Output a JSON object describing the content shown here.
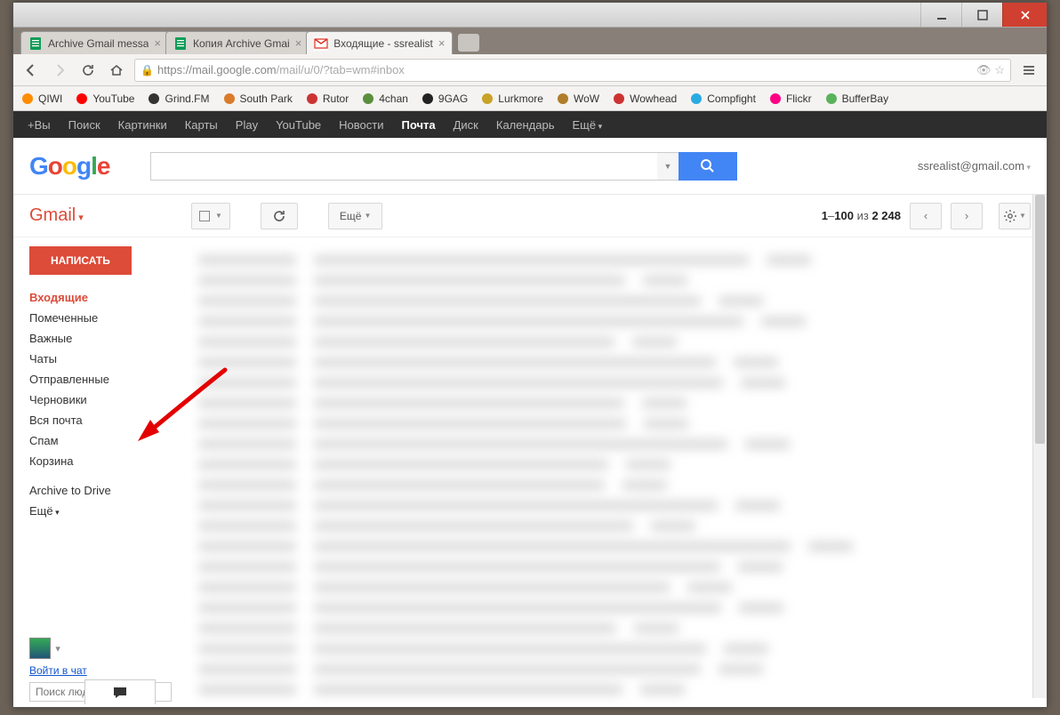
{
  "browser": {
    "tabs": [
      {
        "title": "Archive Gmail messa",
        "active": false,
        "icon": "sheets"
      },
      {
        "title": "Копия Archive Gmai",
        "active": false,
        "icon": "sheets"
      },
      {
        "title": "Входящие - ssrealist",
        "active": true,
        "icon": "gmail"
      }
    ],
    "url_scheme": "https",
    "url_host": "://mail.google.com",
    "url_path": "/mail/u/0/?tab=wm#inbox"
  },
  "bookmarks": [
    {
      "label": "QIWI",
      "color": "#ff8c00"
    },
    {
      "label": "YouTube",
      "color": "#ff0000"
    },
    {
      "label": "Grind.FM",
      "color": "#333"
    },
    {
      "label": "South Park",
      "color": "#d97b2a"
    },
    {
      "label": "Rutor",
      "color": "#cc3333"
    },
    {
      "label": "4chan",
      "color": "#5a8f3d"
    },
    {
      "label": "9GAG",
      "color": "#222"
    },
    {
      "label": "Lurkmore",
      "color": "#c9a227"
    },
    {
      "label": "WoW",
      "color": "#b07d2b"
    },
    {
      "label": "Wowhead",
      "color": "#c33"
    },
    {
      "label": "Compfight",
      "color": "#29abe2"
    },
    {
      "label": "Flickr",
      "color": "#ff0084"
    },
    {
      "label": "BufferBay",
      "color": "#5ab35a"
    }
  ],
  "gnav": [
    {
      "label": "+Вы"
    },
    {
      "label": "Поиск"
    },
    {
      "label": "Картинки"
    },
    {
      "label": "Карты"
    },
    {
      "label": "Play"
    },
    {
      "label": "YouTube"
    },
    {
      "label": "Новости"
    },
    {
      "label": "Почта",
      "active": true
    },
    {
      "label": "Диск"
    },
    {
      "label": "Календарь"
    },
    {
      "label": "Ещё",
      "more": true
    }
  ],
  "user_email": "ssrealist@gmail.com",
  "gmail_label": "Gmail",
  "toolbar": {
    "more": "Ещё",
    "range_start": "1",
    "range_end": "100",
    "range_sep": "из",
    "total": "2 248"
  },
  "compose": "НАПИСАТЬ",
  "nav": [
    {
      "label": "Входящие",
      "active": true
    },
    {
      "label": "Помеченные"
    },
    {
      "label": "Важные"
    },
    {
      "label": "Чаты"
    },
    {
      "label": "Отправленные"
    },
    {
      "label": "Черновики"
    },
    {
      "label": "Вся почта"
    },
    {
      "label": "Спам"
    },
    {
      "label": "Корзина"
    }
  ],
  "nav_extra": "Archive to Drive",
  "nav_more": "Ещё",
  "chat_login": "Войти в чат",
  "people_search_ph": "Поиск людей..."
}
